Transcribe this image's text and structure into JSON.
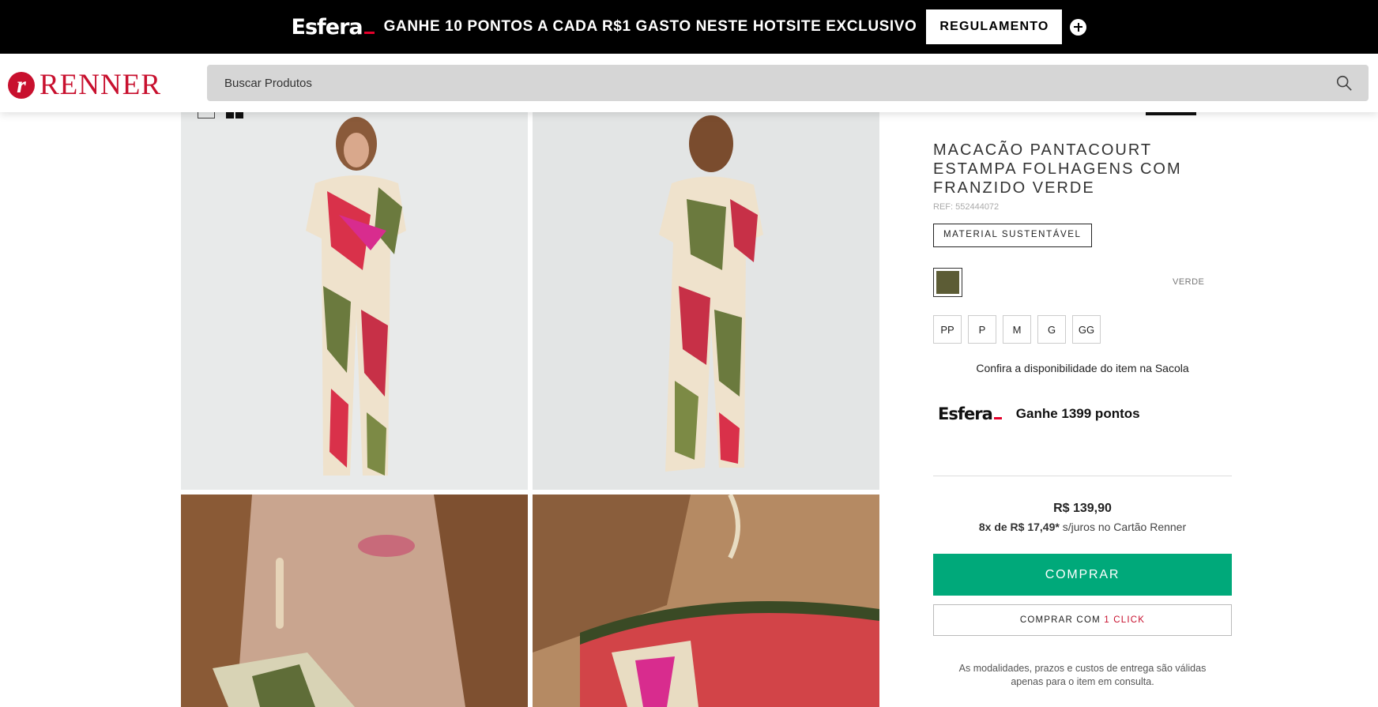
{
  "promo": {
    "logo": "Esfera",
    "text": "GANHE 10 PONTOS A CADA R$1 GASTO NESTE HOTSITE EXCLUSIVO",
    "button_label": "REGULAMENTO"
  },
  "header": {
    "logo": "RENNER",
    "logo_mark": "r",
    "search_placeholder": "Buscar Produtos"
  },
  "product": {
    "title": "MACACÃO PANTACOURT ESTAMPA FOLHAGENS COM FRANZIDO VERDE",
    "ref": "REF: 552444072",
    "badge": "MATERIAL SUSTENTÁVEL",
    "color_name": "VERDE",
    "color_swatch": "#5c5c35",
    "sizes": [
      "PP",
      "P",
      "M",
      "G",
      "GG"
    ],
    "availability": "Confira a disponibilidade do item na Sacola",
    "points_logo": "Esfera",
    "points_text": "Ganhe 1399 pontos",
    "price": "R$ 139,90",
    "installment_bold": "8x de R$ 17,49*",
    "installment_rest": " s/juros no Cartão Renner",
    "buy_label": "COMPRAR",
    "buy_one_click_prefix": "COMPRAR COM ",
    "buy_one_click_accent": "1 CLICK",
    "delivery_note": "As modalidades, prazos e custos de entrega são válidas apenas para o item em consulta."
  },
  "colors": {
    "buy_green": "#00a97a",
    "brand_red": "#c8102e",
    "esfera_red": "#e4002b"
  }
}
